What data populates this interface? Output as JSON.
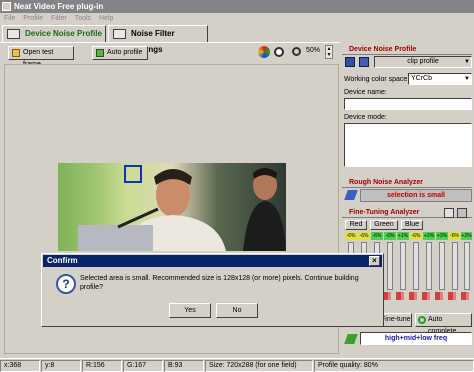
{
  "window": {
    "title": "Neat Video Free plug-in"
  },
  "menu": [
    "File",
    "Profile",
    "Filter",
    "Tools",
    "Help"
  ],
  "tabs": [
    {
      "label": "Device Noise Profile"
    },
    {
      "label": "Noise Filter Settings"
    }
  ],
  "toolbar": {
    "open_test_frame": "Open test frame",
    "auto_profile": "Auto profile",
    "zoom": "50%"
  },
  "right": {
    "device_noise_profile": {
      "title": "Device Noise Profile",
      "profile_select": "clip profile",
      "working_color_space_label": "Working color space:",
      "working_color_space_value": "YCrCb",
      "device_name_label": "Device name:",
      "device_mode_label": "Device mode:"
    },
    "rough_noise_analyzer": {
      "title": "Rough Noise Analyzer",
      "status": "selection is small"
    },
    "fine_tuning_analyzer": {
      "title": "Fine-Tuning Analyzer",
      "channels": [
        "Red",
        "Green",
        "Blue"
      ],
      "chips": [
        "-6%",
        "-6%",
        "-6%",
        "-6%",
        "+1%",
        "-6%",
        "+2%",
        "+3%",
        "-6%",
        "+2%"
      ],
      "fine_tune": "Fine-tune",
      "auto_complete": "Auto complete",
      "freq": "high+mid+low freq"
    }
  },
  "dialog": {
    "title": "Confirm",
    "message": "Selected area is small. Recommended size is 128x128 (or more) pixels. Continue building profile?",
    "yes": "Yes",
    "no": "No",
    "close": "×"
  },
  "status": {
    "x": "x:368",
    "y": "y:8",
    "r": "R:156",
    "g": "G:167",
    "b": "B:93",
    "size": "Size: 720x288 (for one field)",
    "quality": "Profile quality: 80%"
  },
  "colors": {
    "accent_green": "#1a6a1a",
    "section_red": "#a00000",
    "dialog_title": "#0a246a"
  }
}
